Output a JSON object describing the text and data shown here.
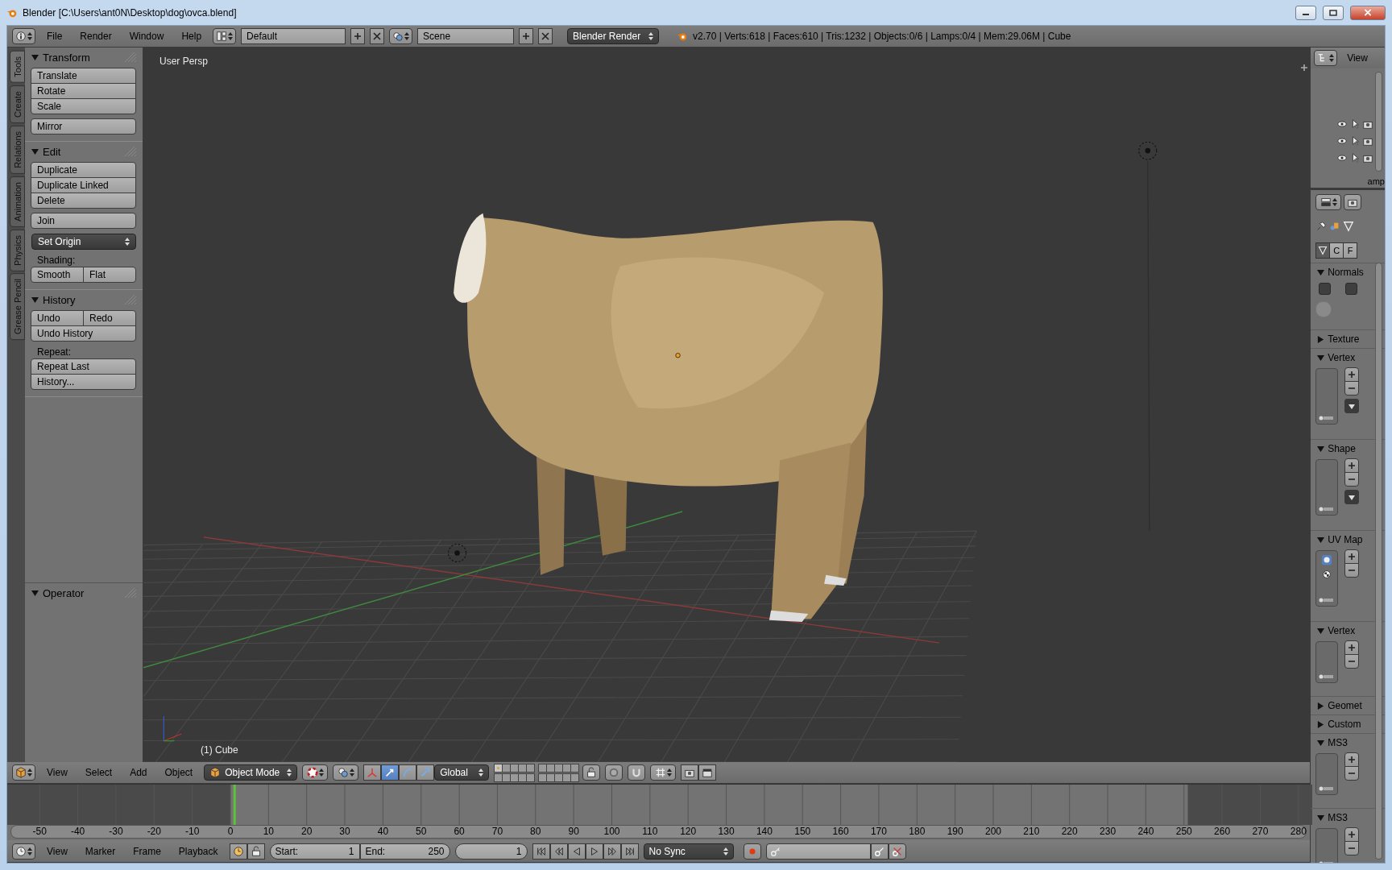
{
  "window": {
    "title": "Blender [C:\\Users\\ant0N\\Desktop\\dog\\ovca.blend]"
  },
  "info_header": {
    "menus": [
      "File",
      "Render",
      "Window",
      "Help"
    ],
    "layout": "Default",
    "scene": "Scene",
    "engine": "Blender Render",
    "stats": "v2.70 | Verts:618 | Faces:610 | Tris:1232 | Objects:0/6 | Lamps:0/4 | Mem:29.06M | Cube"
  },
  "tool_shelf": {
    "tabs": [
      {
        "label": "Tools",
        "selected": true
      },
      {
        "label": "Create",
        "selected": false
      },
      {
        "label": "Relations",
        "selected": false
      },
      {
        "label": "Animation",
        "selected": false
      },
      {
        "label": "Physics",
        "selected": false
      },
      {
        "label": "Grease Pencil",
        "selected": false
      }
    ],
    "panels": [
      {
        "title": "Transform",
        "expanded": true,
        "items": [
          {
            "kind": "block",
            "rows": [
              [
                "Translate"
              ],
              [
                "Rotate"
              ],
              [
                "Scale"
              ]
            ]
          },
          {
            "kind": "block",
            "rows": [
              [
                "Mirror"
              ]
            ]
          }
        ]
      },
      {
        "title": "Edit",
        "expanded": true,
        "items": [
          {
            "kind": "block",
            "rows": [
              [
                "Duplicate"
              ],
              [
                "Duplicate Linked"
              ],
              [
                "Delete"
              ]
            ]
          },
          {
            "kind": "block",
            "rows": [
              [
                "Join"
              ]
            ]
          },
          {
            "kind": "dropdown",
            "text": "Set Origin"
          },
          {
            "kind": "label",
            "text": "Shading:"
          },
          {
            "kind": "block",
            "rows": [
              [
                "Smooth",
                "Flat"
              ]
            ]
          }
        ]
      },
      {
        "title": "History",
        "expanded": true,
        "items": [
          {
            "kind": "block",
            "rows": [
              [
                "Undo",
                "Redo"
              ],
              [
                "Undo History"
              ]
            ]
          },
          {
            "kind": "label",
            "text": "Repeat:"
          },
          {
            "kind": "block",
            "rows": [
              [
                "Repeat Last"
              ],
              [
                "History..."
              ]
            ]
          }
        ]
      }
    ],
    "operator": {
      "title": "Operator",
      "expanded": true
    }
  },
  "viewport": {
    "view_name": "User Persp",
    "object_name": "(1) Cube"
  },
  "view3d_header": {
    "menus": [
      "View",
      "Select",
      "Add",
      "Object"
    ],
    "mode": "Object Mode",
    "manipulators": [
      {
        "kind": "axes",
        "selected": false
      },
      {
        "kind": "translate",
        "selected": true
      },
      {
        "kind": "rotate",
        "selected": false
      },
      {
        "kind": "scale",
        "selected": false
      }
    ],
    "orientation": "Global",
    "layers": [
      {
        "selected": true,
        "used": true
      },
      {
        "selected": false,
        "used": false
      },
      {
        "selected": false,
        "used": false
      },
      {
        "selected": false,
        "used": false
      },
      {
        "selected": false,
        "used": false
      },
      {
        "selected": false,
        "used": false
      },
      {
        "selected": false,
        "used": false
      },
      {
        "selected": false,
        "used": false
      },
      {
        "selected": false,
        "used": false
      },
      {
        "selected": false,
        "used": false
      },
      {
        "selected": false,
        "used": false
      },
      {
        "selected": false,
        "used": false
      },
      {
        "selected": false,
        "used": false
      },
      {
        "selected": false,
        "used": false
      },
      {
        "selected": false,
        "used": false
      },
      {
        "selected": false,
        "used": false
      },
      {
        "selected": false,
        "used": false
      },
      {
        "selected": false,
        "used": false
      },
      {
        "selected": false,
        "used": false
      },
      {
        "selected": false,
        "used": false
      }
    ]
  },
  "timeline": {
    "ruler": [
      "-50",
      "-40",
      "-30",
      "-20",
      "-10",
      "0",
      "10",
      "20",
      "30",
      "40",
      "50",
      "60",
      "70",
      "80",
      "90",
      "100",
      "110",
      "120",
      "130",
      "140",
      "150",
      "160",
      "170",
      "180",
      "190",
      "200",
      "210",
      "220",
      "230",
      "240",
      "250",
      "260",
      "270",
      "280"
    ]
  },
  "timeline_header": {
    "menus": [
      "View",
      "Marker",
      "Frame",
      "Playback"
    ],
    "start_label": "Start:",
    "start": "1",
    "end_label": "End:",
    "end": "250",
    "current": "1",
    "sync": "No Sync"
  },
  "outliner": {
    "view": "View",
    "partial_text": "amp"
  },
  "properties": {
    "data_tabs": [
      {
        "kind": "icon",
        "selected": true
      },
      {
        "kind": "text",
        "label": "C",
        "selected": false
      },
      {
        "kind": "text",
        "label": "F",
        "selected": false
      }
    ],
    "panels": [
      {
        "title": "Normals",
        "expanded": true,
        "kind": "normals",
        "toggles": [
          {
            "checked": false
          },
          {
            "checked": false
          }
        ]
      },
      {
        "title": "Texture",
        "expanded": false
      },
      {
        "title": "Vertex",
        "expanded": true,
        "kind": "list_menu"
      },
      {
        "title": "Shape",
        "expanded": true,
        "kind": "list_menu"
      },
      {
        "title": "UV Map",
        "expanded": true,
        "kind": "list_uv"
      },
      {
        "title": "Vertex",
        "expanded": true,
        "kind": "list"
      },
      {
        "title": "Geomet",
        "expanded": false
      },
      {
        "title": "Custom",
        "expanded": false
      },
      {
        "title": "MS3",
        "expanded": true,
        "kind": "list"
      },
      {
        "title": "MS3",
        "expanded": true,
        "kind": "list"
      }
    ]
  }
}
